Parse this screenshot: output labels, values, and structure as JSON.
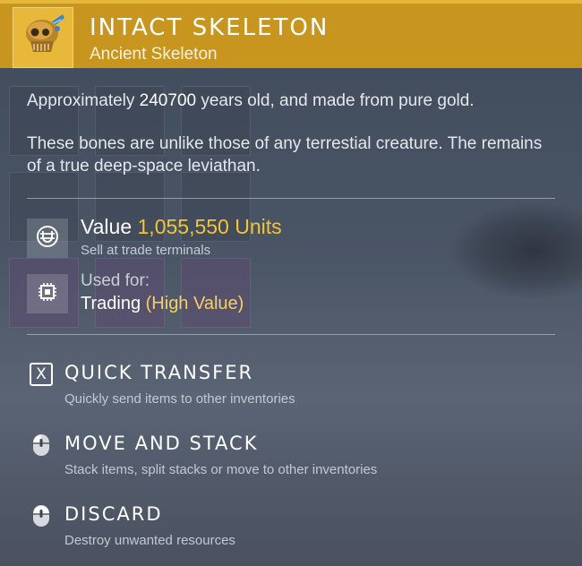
{
  "item": {
    "title": "INTACT SKELETON",
    "subtitle": "Ancient Skeleton",
    "icon": "golden-skull-icon",
    "accent_color": "#c8961f"
  },
  "description": {
    "age_prefix": "Approximately ",
    "age_value": "240700",
    "age_suffix": " years old, and made from pure gold.",
    "lore": "These bones are unlike those of any terrestial creature. The remains of a true deep-space leviathan."
  },
  "value": {
    "label": "Value",
    "amount": "1,055,550 Units",
    "note": "Sell at trade terminals",
    "icon": "units-currency-icon",
    "amount_color": "#f5c430"
  },
  "usage": {
    "label": "Used for:",
    "category": "Trading",
    "qualifier": "(High Value)",
    "icon": "trade-chip-icon"
  },
  "actions": [
    {
      "title": "QUICK TRANSFER",
      "description": "Quickly send items to other inventories",
      "key": "X",
      "icon": "x-key-icon"
    },
    {
      "title": "MOVE AND STACK",
      "description": "Stack items, split stacks or move to other inventories",
      "icon": "mouse-left-click-icon"
    },
    {
      "title": "DISCARD",
      "description": "Destroy unwanted resources",
      "icon": "mouse-hold-icon"
    }
  ]
}
